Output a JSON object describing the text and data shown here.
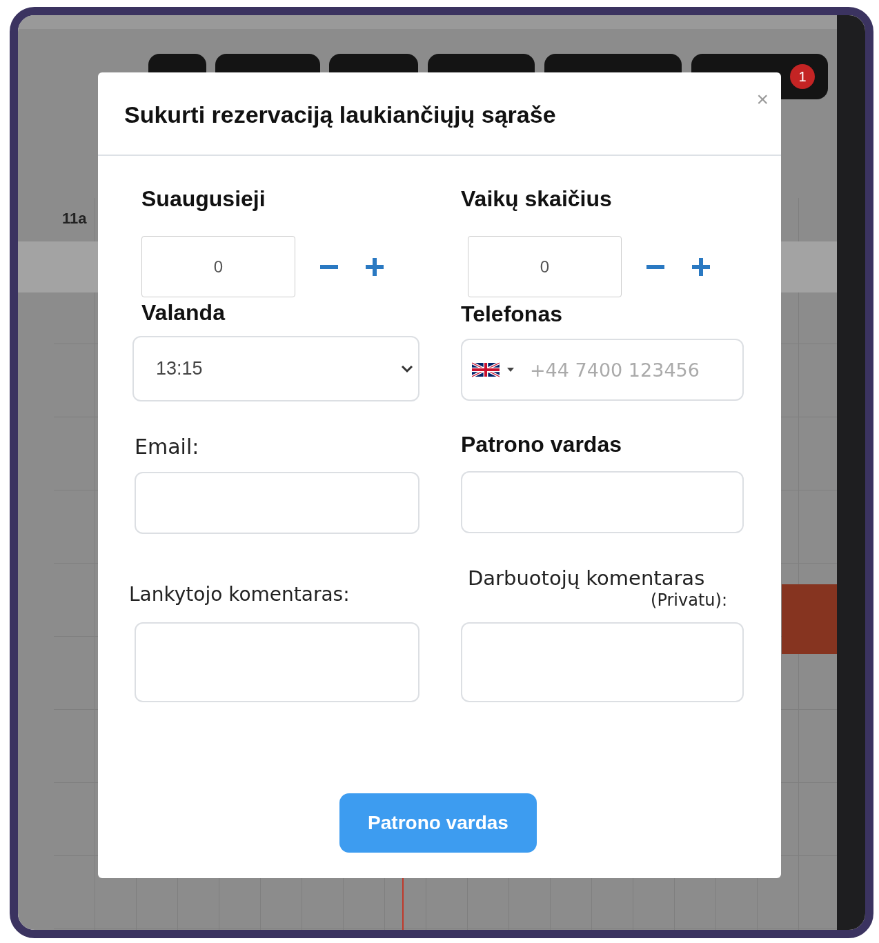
{
  "background": {
    "time_label": "11a",
    "badge": "1"
  },
  "modal": {
    "title": "Sukurti rezervaciją laukiančiųjų sąraše",
    "close": "×",
    "counters": [
      {
        "label": "Suaugusieji",
        "value": "0"
      },
      {
        "label": "Vaikų skaičius",
        "value": "0"
      }
    ],
    "time": {
      "label": "Valanda",
      "value": "13:15"
    },
    "phone": {
      "label": "Telefonas",
      "placeholder": "+44 7400 123456"
    },
    "email": {
      "label": "Email:"
    },
    "patron": {
      "label": "Patrono vardas"
    },
    "visitor_comment": {
      "label": "Lankytojo komentaras:"
    },
    "staff_comment": {
      "label": "Darbuotojų komentaras",
      "note": "(Privatu):"
    },
    "submit": "Patrono vardas"
  }
}
